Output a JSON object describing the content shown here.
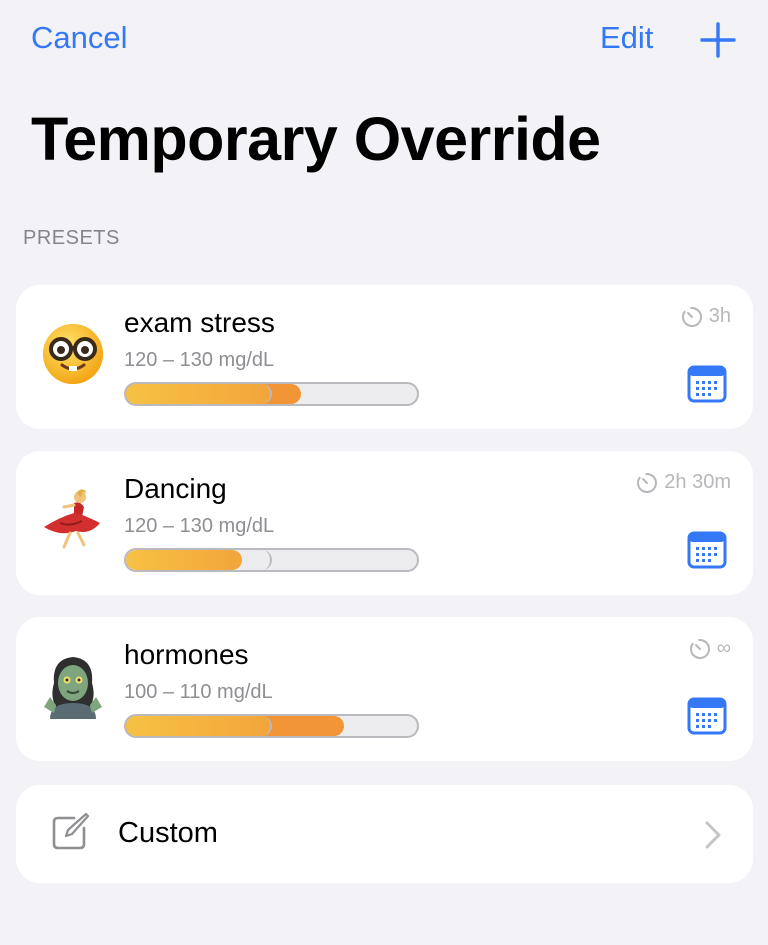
{
  "nav": {
    "cancel_label": "Cancel",
    "edit_label": "Edit",
    "add_icon": "plus-icon",
    "accent_color": "#3478f6"
  },
  "page": {
    "title": "Temporary Override",
    "section_header": "PRESETS"
  },
  "presets": [
    {
      "emoji_icon": "nerd-face-emoji",
      "name": "exam stress",
      "range": "120 – 130 mg/dL",
      "duration": "3h",
      "bar_yellow_fraction": 0.5,
      "bar_orange_fraction": 0.6
    },
    {
      "emoji_icon": "woman-dancing-emoji",
      "name": "Dancing",
      "range": "120 – 130 mg/dL",
      "duration": "2h 30m",
      "bar_yellow_fraction": 0.4,
      "bar_orange_fraction": 0
    },
    {
      "emoji_icon": "zombie-emoji",
      "name": "hormones",
      "range": "100 – 110 mg/dL",
      "duration": "∞",
      "bar_yellow_fraction": 0.5,
      "bar_orange_fraction": 0.75
    }
  ],
  "custom": {
    "label": "Custom",
    "icon": "square-pencil-icon"
  }
}
